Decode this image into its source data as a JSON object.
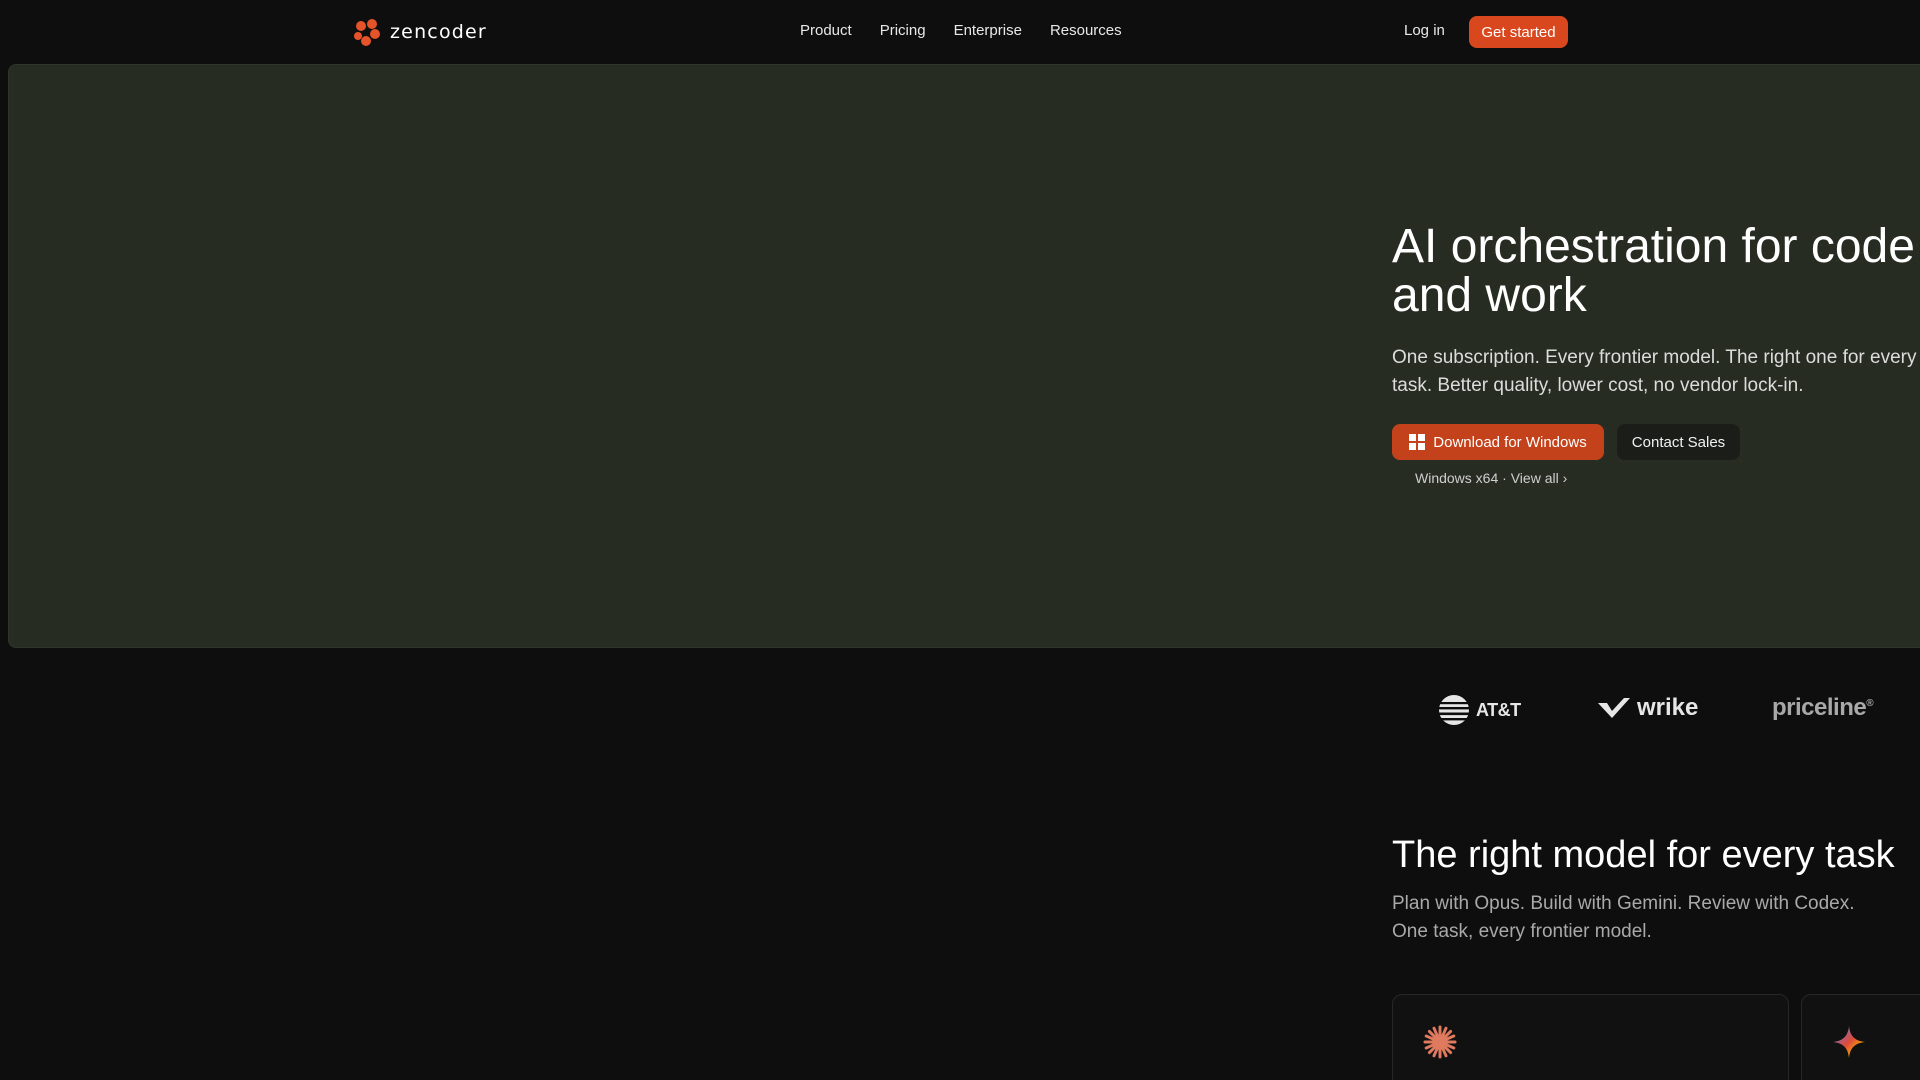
{
  "brand": {
    "name": "zencoder",
    "accent": "#d9471e"
  },
  "nav": {
    "links": [
      {
        "label": "Product"
      },
      {
        "label": "Pricing"
      },
      {
        "label": "Enterprise"
      },
      {
        "label": "Resources"
      }
    ],
    "login_label": "Log in",
    "cta_label": "Get started"
  },
  "hero": {
    "title_line1": "AI orchestration for code",
    "title_line2": "and work",
    "subtitle": "One subscription. Every frontier model. The right one for every task. Better quality, lower cost, no vendor lock-in.",
    "download_label": "Download for Windows",
    "download_icon": "windows-icon",
    "contact_label": "Contact Sales",
    "platform_text": "Windows x64",
    "separator": "·",
    "view_all_label": "View all ›"
  },
  "logos": {
    "att": "AT&T",
    "wrike": "wrike",
    "priceline": "priceline",
    "priceline_mark": "®"
  },
  "models": {
    "title": "The right model for every task",
    "subtitle": "Plan with Opus. Build with Gemini. Review with Codex. One task, every frontier model.",
    "cards": [
      {
        "icon": "claude-sunburst-icon",
        "color": "#e07a5f"
      },
      {
        "icon": "gemini-sparkle-icon",
        "color": "#4f86f7"
      }
    ]
  }
}
